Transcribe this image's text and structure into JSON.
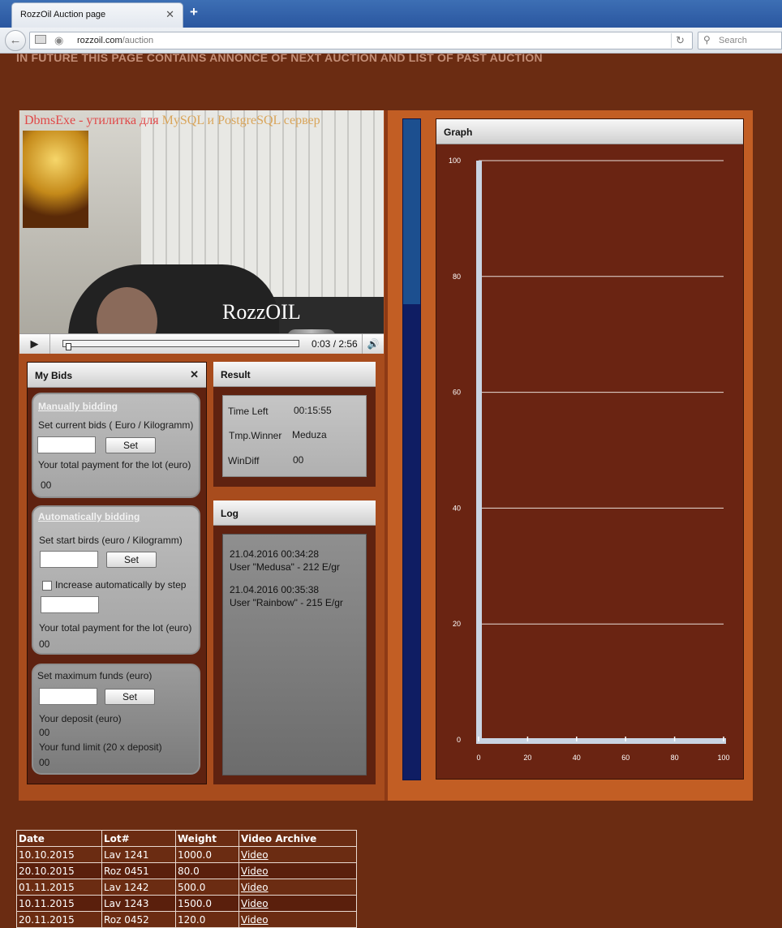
{
  "browser": {
    "tab_title": "RozzOil Auction page",
    "tab_close": "✕",
    "new_tab": "+",
    "url_host": "rozzoil.com",
    "url_path": "/auction",
    "search_placeholder": "Search"
  },
  "announcement": "IN FUTURE THIS PAGE CONTAINS ANNONCE OF NEXT AUCTION AND LIST OF PAST AUCTION",
  "video": {
    "ticker_red": "DbmsExe - утилитка для",
    "ticker_rest": "MySQL и PostgreSQL сервер",
    "caption": "RozzOIL",
    "time": "0:03 / 2:56",
    "progress": 0.017
  },
  "my_bids": {
    "title": "My Bids",
    "close": "✕",
    "manual": {
      "title": "Manually bidding",
      "label": "Set current bids  ( Euro / Kilogramm)",
      "set": "Set",
      "payment_label": "Your total payment for the lot (euro)",
      "payment_value": "00"
    },
    "auto": {
      "title": "Automatically bidding",
      "label": "Set start birds (euro / Kilogramm)",
      "set": "Set",
      "checkbox_label": "Increase automatically by step",
      "payment_label": "Your total payment for the lot (euro)",
      "payment_value": "00"
    },
    "funds": {
      "label": "Set maximum funds (euro)",
      "set": "Set",
      "deposit_label": "Your deposit (euro)",
      "deposit_value": "00",
      "limit_label": "Your fund limit (20 x deposit)",
      "limit_value": "00"
    }
  },
  "result": {
    "title": "Result",
    "time_left_label": "Time Left",
    "time_left_value": "00:15:55",
    "winner_label": "Tmp.Winner",
    "winner_value": "Meduza",
    "windiff_label": "WinDiff",
    "windiff_value": "00"
  },
  "log": {
    "title": "Log",
    "entries": [
      {
        "time": "21.04.2016 00:34:28",
        "text": "User \"Medusa\" - 212 E/gr"
      },
      {
        "time": "21.04.2016 00:35:38",
        "text": "User \"Rainbow\" - 215 E/gr"
      }
    ]
  },
  "progress_bar": {
    "fill_fraction": 0.28
  },
  "graph": {
    "title": "Graph"
  },
  "chart_data": {
    "type": "line",
    "title": "Graph",
    "xlabel": "",
    "ylabel": "",
    "x_ticks": [
      "0",
      "20",
      "40",
      "60",
      "80",
      "100"
    ],
    "y_ticks": [
      "0",
      "20",
      "40",
      "60",
      "80",
      "100"
    ],
    "xlim": [
      0,
      100
    ],
    "ylim": [
      0,
      100
    ],
    "grid": true,
    "series": []
  },
  "archive": {
    "headers": [
      "Date",
      "Lot#",
      "Weight",
      "Video Archive"
    ],
    "rows": [
      [
        "10.10.2015",
        "Lav 1241",
        "1000.0",
        "Video"
      ],
      [
        "20.10.2015",
        "Roz 0451",
        "80.0",
        "Video"
      ],
      [
        "01.11.2015",
        "Lav 1242",
        "500.0",
        "Video"
      ],
      [
        "10.11.2015",
        "Lav 1243",
        "1500.0",
        "Video"
      ],
      [
        "20.11.2015",
        "Roz 0452",
        "120.0",
        "Video"
      ]
    ]
  },
  "colors": {
    "page_bg": "#6b2c12",
    "panel_orange": "#c25e24",
    "bar_fill": "#1c4f8f",
    "bar_track": "#0f1d63"
  }
}
